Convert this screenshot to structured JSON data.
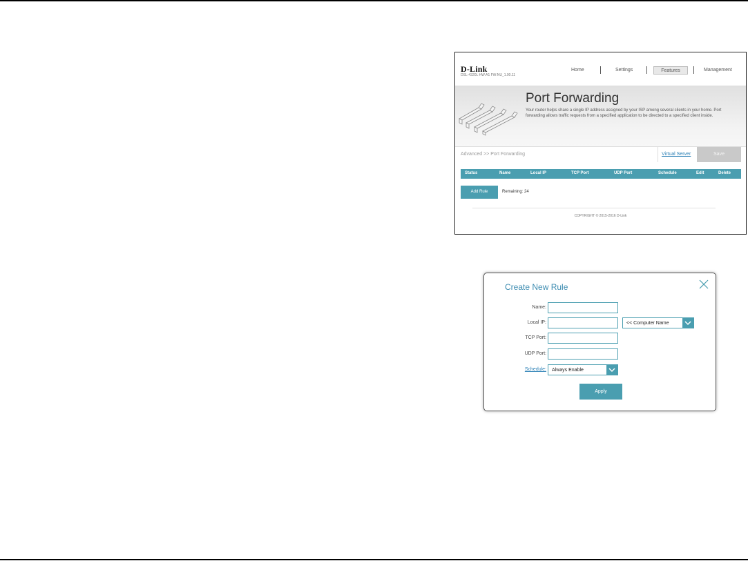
{
  "router": {
    "brand": "D-Link",
    "hw_info": "DSL-4320L   HW:A1   FW:NU_1.00.11",
    "nav": {
      "home": "Home",
      "settings": "Settings",
      "features": "Features",
      "management": "Management"
    },
    "banner": {
      "title": "Port Forwarding",
      "description": "Your router helps share a single IP address assigned by your ISP among several clients in your home. Port forwarding allows traffic requests from a specified application to be directed to a specified client inside."
    },
    "breadcrumb": "Advanced >> Port Forwarding",
    "virtual_server_link": "Virtual Server",
    "save_label": "Save",
    "table_headers": [
      "Status",
      "Name",
      "Local IP",
      "TCP Port",
      "UDP Port",
      "Schedule",
      "Edit",
      "Delete"
    ],
    "add_rule_label": "Add Rule",
    "remaining_text": "Remaining: 24",
    "copyright": "COPYRIGHT © 2015-2016 D-Link"
  },
  "dialog": {
    "title": "Create New Rule",
    "labels": {
      "name": "Name:",
      "local_ip": "Local IP:",
      "tcp_port": "TCP Port:",
      "udp_port": "UDP Port:",
      "schedule": "Schedule:"
    },
    "computer_name_select": "<< Computer Name",
    "schedule_select": "Always Enable",
    "apply_label": "Apply"
  },
  "colors": {
    "accent": "#4a9eb0",
    "link": "#2a7fb5",
    "dialog_title": "#3b8bb0",
    "save_disabled": "#c9c9c9"
  },
  "icons": [
    "stairs-illustration-icon",
    "close-icon",
    "chevron-down-icon"
  ]
}
